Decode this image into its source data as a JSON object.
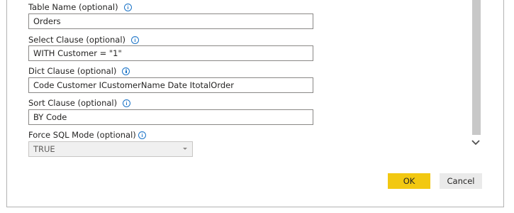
{
  "fields": {
    "table_name": {
      "label": "Table Name (optional)",
      "value": "Orders"
    },
    "select_clause": {
      "label": "Select Clause (optional)",
      "value": "WITH Customer = \"1\""
    },
    "dict_clause": {
      "label": "Dict Clause (optional)",
      "value": "Code Customer ICustomerName Date ItotalOrder"
    },
    "sort_clause": {
      "label": "Sort Clause (optional)",
      "value": "BY Code"
    },
    "force_sql_mode": {
      "label": "Force SQL Mode (optional)",
      "value": "TRUE"
    }
  },
  "buttons": {
    "ok": "OK",
    "cancel": "Cancel"
  },
  "colors": {
    "ok_button": "#f2c811",
    "info_icon": "#1a73c7",
    "cancel_button": "#eaeaea"
  },
  "icons": {
    "info": "info-icon",
    "dropdown": "chevron-down-icon",
    "scroll_down": "scroll-down-icon"
  }
}
